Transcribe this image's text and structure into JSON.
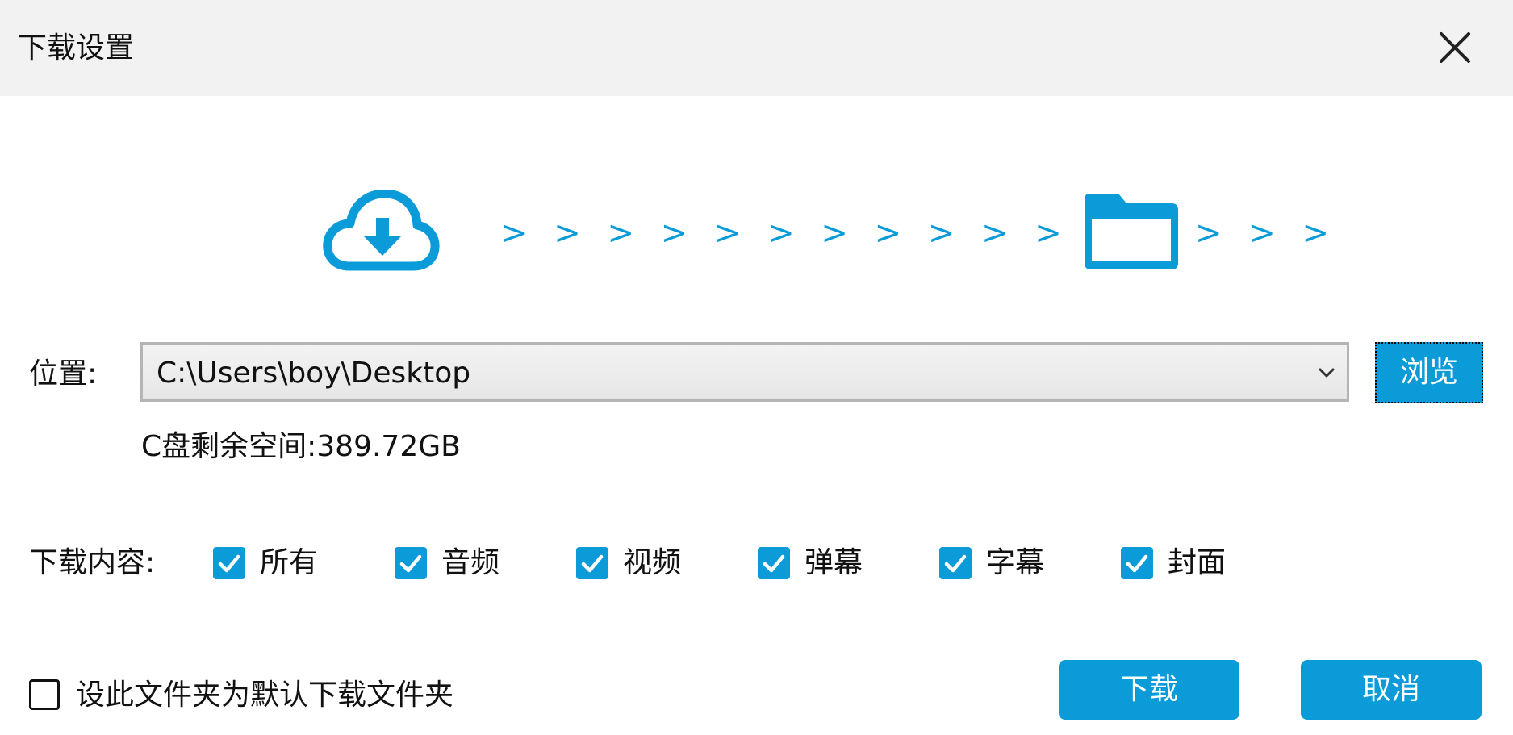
{
  "dialog": {
    "title": "下载设置",
    "transfer_arrows": "> > > > > > > > > > > > > > > >"
  },
  "location": {
    "label": "位置:",
    "path": "C:\\Users\\boy\\Desktop",
    "browse_label": "浏览",
    "free_space": "C盘剩余空间:389.72GB"
  },
  "content": {
    "label": "下载内容:",
    "options": [
      {
        "label": "所有",
        "checked": true
      },
      {
        "label": "音频",
        "checked": true
      },
      {
        "label": "视频",
        "checked": true
      },
      {
        "label": "弹幕",
        "checked": true
      },
      {
        "label": "字幕",
        "checked": true
      },
      {
        "label": "封面",
        "checked": true
      }
    ]
  },
  "footer": {
    "default_folder_label": "设此文件夹为默认下载文件夹",
    "default_folder_checked": false,
    "download_label": "下载",
    "cancel_label": "取消"
  },
  "colors": {
    "accent": "#0a9bd8",
    "titlebar_bg": "#f2f2f2"
  },
  "icons": {
    "close": "close-icon",
    "cloud": "cloud-download-icon",
    "folder": "folder-icon",
    "chevron": "chevron-down-icon",
    "check": "checkmark-icon"
  }
}
